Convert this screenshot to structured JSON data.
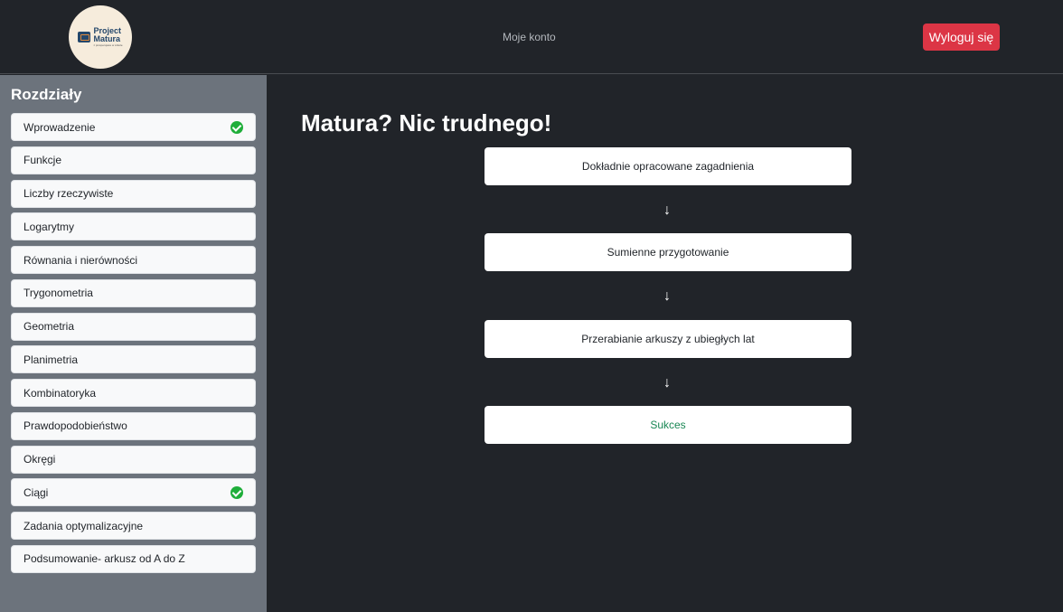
{
  "header": {
    "logo": {
      "line1": "Project",
      "line2": "Matura",
      "subtitle": "z prosperujace w szkole"
    },
    "nav_link": "Moje konto",
    "logout_label": "Wyloguj się"
  },
  "sidebar": {
    "title": "Rozdziały",
    "items": [
      {
        "label": "Wprowadzenie",
        "completed": true
      },
      {
        "label": "Funkcje",
        "completed": false
      },
      {
        "label": "Liczby rzeczywiste",
        "completed": false
      },
      {
        "label": "Logarytmy",
        "completed": false
      },
      {
        "label": "Równania i nierówności",
        "completed": false
      },
      {
        "label": "Trygonometria",
        "completed": false
      },
      {
        "label": "Geometria",
        "completed": false
      },
      {
        "label": "Planimetria",
        "completed": false
      },
      {
        "label": "Kombinatoryka",
        "completed": false
      },
      {
        "label": "Prawdopodobieństwo",
        "completed": false
      },
      {
        "label": "Okręgi",
        "completed": false
      },
      {
        "label": "Ciągi",
        "completed": true
      },
      {
        "label": "Zadania optymalizacyjne",
        "completed": false
      },
      {
        "label": "Podsumowanie- arkusz od A do Z",
        "completed": false
      }
    ]
  },
  "main": {
    "headline": "Matura? Nic trudnego!",
    "steps": [
      "Dokładnie opracowane zagadnienia",
      "Sumienne przygotowanie",
      "Przerabianie arkuszy z ubiegłych lat",
      "Sukces"
    ],
    "arrow": "↓"
  },
  "colors": {
    "background": "#212429",
    "sidebar": "#6c737c",
    "logout": "#dc3545",
    "check": "#1fae3a",
    "success_text": "#198754"
  }
}
